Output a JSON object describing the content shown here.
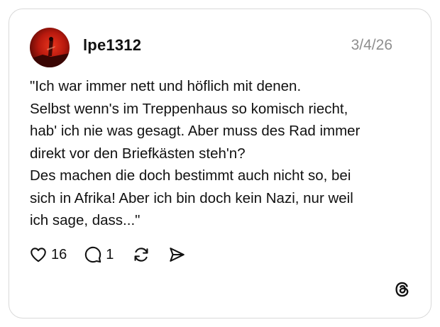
{
  "post": {
    "username": "lpe1312",
    "date": "3/4/26",
    "text_lines": [
      "\"Ich war immer nett und höflich mit denen.",
      "Selbst wenn's im Treppenhaus so komisch riecht,",
      "hab' ich nie was gesagt. Aber muss des Rad immer",
      "direkt vor den Briefkästen steh'n?",
      "Des machen die doch bestimmt auch nicht so, bei",
      "sich in Afrika! Aber ich bin doch kein Nazi, nur weil",
      "ich sage, dass...\""
    ]
  },
  "actions": {
    "like_count": "16",
    "reply_count": "1"
  },
  "icons": {
    "like": "heart-icon",
    "reply": "comment-icon",
    "repost": "repost-icon",
    "share": "send-icon",
    "brand": "threads-logo-icon"
  },
  "colors": {
    "text": "#111111",
    "muted": "#8e8e8e",
    "border": "#d9d9d9",
    "avatar_red": "#c21a10"
  }
}
